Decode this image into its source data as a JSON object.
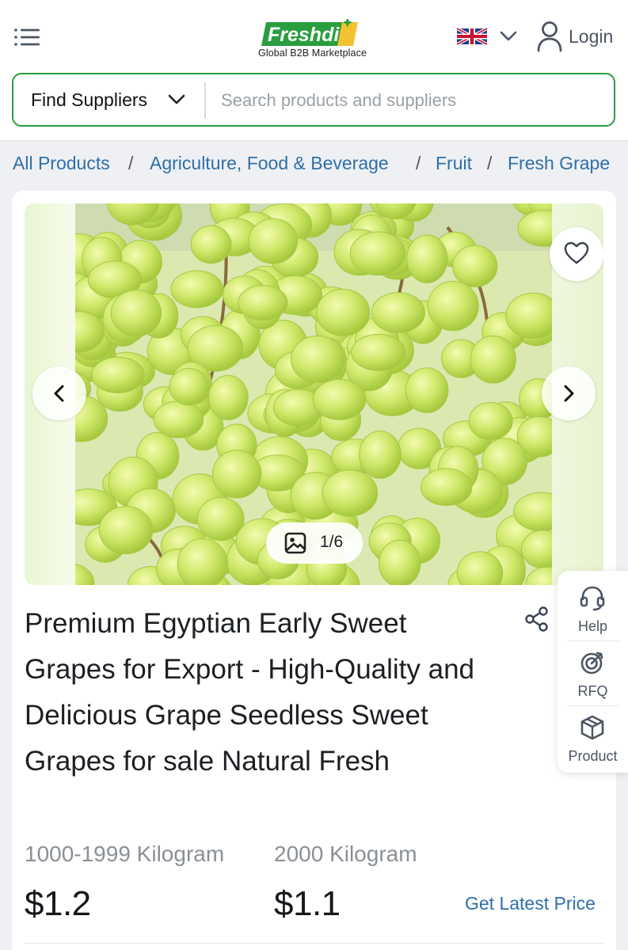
{
  "header": {
    "logo_text": "Freshdi",
    "tagline": "Global B2B Marketplace",
    "login_label": "Login",
    "language_icon": "uk-flag-icon"
  },
  "search": {
    "category_label": "Find Suppliers",
    "placeholder": "Search products and suppliers"
  },
  "breadcrumb": {
    "items": [
      "All Products",
      "Agriculture, Food & Beverage",
      "Fruit",
      "Fresh Grape"
    ],
    "separator": "/"
  },
  "gallery": {
    "counter": "1/6",
    "image_subject": "green-grapes-photo"
  },
  "product": {
    "title": "Premium Egyptian Early Sweet Grapes for Export - High-Quality and Delicious Grape Seedless Sweet Grapes for sale Natural Fresh",
    "price_tiers": [
      {
        "quantity": "1000-1999 Kilogram",
        "price": "$1.2"
      },
      {
        "quantity": "2000 Kilogram",
        "price": "$1.1"
      }
    ],
    "latest_price_label": "Get Latest Price"
  },
  "side_panel": {
    "items": [
      {
        "label": "Help",
        "icon": "headset-icon"
      },
      {
        "label": "RFQ",
        "icon": "target-icon"
      },
      {
        "label": "Product",
        "icon": "box-icon"
      }
    ]
  },
  "colors": {
    "brand_green": "#2a9d3e",
    "link_blue": "#2f6fa8"
  }
}
